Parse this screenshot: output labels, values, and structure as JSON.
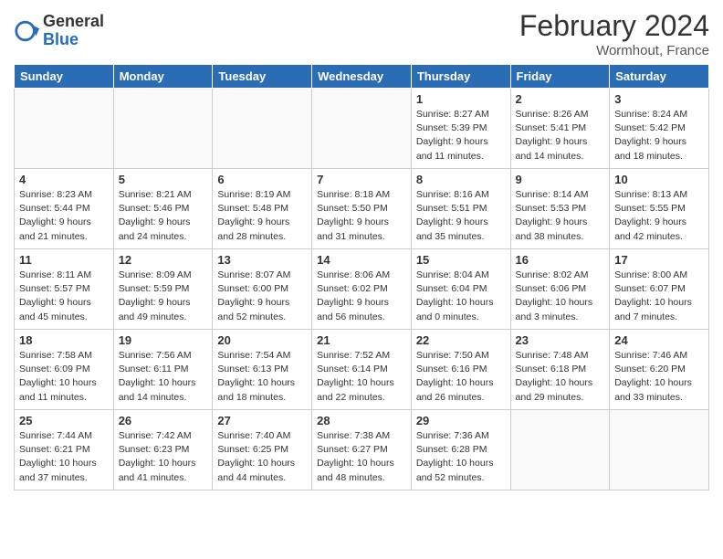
{
  "logo": {
    "general": "General",
    "blue": "Blue"
  },
  "title": "February 2024",
  "location": "Wormhout, France",
  "headers": [
    "Sunday",
    "Monday",
    "Tuesday",
    "Wednesday",
    "Thursday",
    "Friday",
    "Saturday"
  ],
  "weeks": [
    [
      {
        "day": "",
        "info": ""
      },
      {
        "day": "",
        "info": ""
      },
      {
        "day": "",
        "info": ""
      },
      {
        "day": "",
        "info": ""
      },
      {
        "day": "1",
        "info": "Sunrise: 8:27 AM\nSunset: 5:39 PM\nDaylight: 9 hours\nand 11 minutes."
      },
      {
        "day": "2",
        "info": "Sunrise: 8:26 AM\nSunset: 5:41 PM\nDaylight: 9 hours\nand 14 minutes."
      },
      {
        "day": "3",
        "info": "Sunrise: 8:24 AM\nSunset: 5:42 PM\nDaylight: 9 hours\nand 18 minutes."
      }
    ],
    [
      {
        "day": "4",
        "info": "Sunrise: 8:23 AM\nSunset: 5:44 PM\nDaylight: 9 hours\nand 21 minutes."
      },
      {
        "day": "5",
        "info": "Sunrise: 8:21 AM\nSunset: 5:46 PM\nDaylight: 9 hours\nand 24 minutes."
      },
      {
        "day": "6",
        "info": "Sunrise: 8:19 AM\nSunset: 5:48 PM\nDaylight: 9 hours\nand 28 minutes."
      },
      {
        "day": "7",
        "info": "Sunrise: 8:18 AM\nSunset: 5:50 PM\nDaylight: 9 hours\nand 31 minutes."
      },
      {
        "day": "8",
        "info": "Sunrise: 8:16 AM\nSunset: 5:51 PM\nDaylight: 9 hours\nand 35 minutes."
      },
      {
        "day": "9",
        "info": "Sunrise: 8:14 AM\nSunset: 5:53 PM\nDaylight: 9 hours\nand 38 minutes."
      },
      {
        "day": "10",
        "info": "Sunrise: 8:13 AM\nSunset: 5:55 PM\nDaylight: 9 hours\nand 42 minutes."
      }
    ],
    [
      {
        "day": "11",
        "info": "Sunrise: 8:11 AM\nSunset: 5:57 PM\nDaylight: 9 hours\nand 45 minutes."
      },
      {
        "day": "12",
        "info": "Sunrise: 8:09 AM\nSunset: 5:59 PM\nDaylight: 9 hours\nand 49 minutes."
      },
      {
        "day": "13",
        "info": "Sunrise: 8:07 AM\nSunset: 6:00 PM\nDaylight: 9 hours\nand 52 minutes."
      },
      {
        "day": "14",
        "info": "Sunrise: 8:06 AM\nSunset: 6:02 PM\nDaylight: 9 hours\nand 56 minutes."
      },
      {
        "day": "15",
        "info": "Sunrise: 8:04 AM\nSunset: 6:04 PM\nDaylight: 10 hours\nand 0 minutes."
      },
      {
        "day": "16",
        "info": "Sunrise: 8:02 AM\nSunset: 6:06 PM\nDaylight: 10 hours\nand 3 minutes."
      },
      {
        "day": "17",
        "info": "Sunrise: 8:00 AM\nSunset: 6:07 PM\nDaylight: 10 hours\nand 7 minutes."
      }
    ],
    [
      {
        "day": "18",
        "info": "Sunrise: 7:58 AM\nSunset: 6:09 PM\nDaylight: 10 hours\nand 11 minutes."
      },
      {
        "day": "19",
        "info": "Sunrise: 7:56 AM\nSunset: 6:11 PM\nDaylight: 10 hours\nand 14 minutes."
      },
      {
        "day": "20",
        "info": "Sunrise: 7:54 AM\nSunset: 6:13 PM\nDaylight: 10 hours\nand 18 minutes."
      },
      {
        "day": "21",
        "info": "Sunrise: 7:52 AM\nSunset: 6:14 PM\nDaylight: 10 hours\nand 22 minutes."
      },
      {
        "day": "22",
        "info": "Sunrise: 7:50 AM\nSunset: 6:16 PM\nDaylight: 10 hours\nand 26 minutes."
      },
      {
        "day": "23",
        "info": "Sunrise: 7:48 AM\nSunset: 6:18 PM\nDaylight: 10 hours\nand 29 minutes."
      },
      {
        "day": "24",
        "info": "Sunrise: 7:46 AM\nSunset: 6:20 PM\nDaylight: 10 hours\nand 33 minutes."
      }
    ],
    [
      {
        "day": "25",
        "info": "Sunrise: 7:44 AM\nSunset: 6:21 PM\nDaylight: 10 hours\nand 37 minutes."
      },
      {
        "day": "26",
        "info": "Sunrise: 7:42 AM\nSunset: 6:23 PM\nDaylight: 10 hours\nand 41 minutes."
      },
      {
        "day": "27",
        "info": "Sunrise: 7:40 AM\nSunset: 6:25 PM\nDaylight: 10 hours\nand 44 minutes."
      },
      {
        "day": "28",
        "info": "Sunrise: 7:38 AM\nSunset: 6:27 PM\nDaylight: 10 hours\nand 48 minutes."
      },
      {
        "day": "29",
        "info": "Sunrise: 7:36 AM\nSunset: 6:28 PM\nDaylight: 10 hours\nand 52 minutes."
      },
      {
        "day": "",
        "info": ""
      },
      {
        "day": "",
        "info": ""
      }
    ]
  ]
}
